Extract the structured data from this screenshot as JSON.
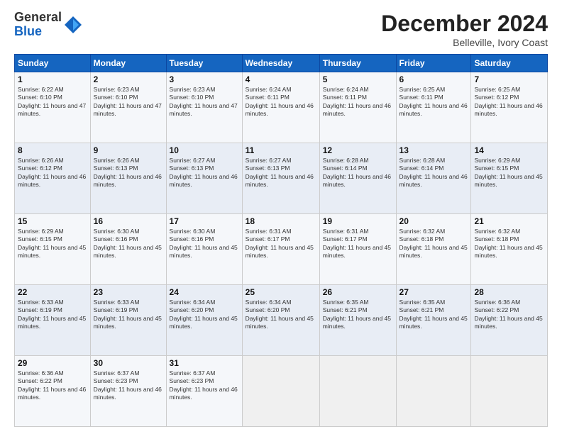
{
  "logo": {
    "general": "General",
    "blue": "Blue"
  },
  "title": "December 2024",
  "location": "Belleville, Ivory Coast",
  "days_header": [
    "Sunday",
    "Monday",
    "Tuesday",
    "Wednesday",
    "Thursday",
    "Friday",
    "Saturday"
  ],
  "weeks": [
    [
      {
        "day": "1",
        "sunrise": "6:22 AM",
        "sunset": "6:10 PM",
        "daylight": "11 hours and 47 minutes."
      },
      {
        "day": "2",
        "sunrise": "6:23 AM",
        "sunset": "6:10 PM",
        "daylight": "11 hours and 47 minutes."
      },
      {
        "day": "3",
        "sunrise": "6:23 AM",
        "sunset": "6:10 PM",
        "daylight": "11 hours and 47 minutes."
      },
      {
        "day": "4",
        "sunrise": "6:24 AM",
        "sunset": "6:11 PM",
        "daylight": "11 hours and 46 minutes."
      },
      {
        "day": "5",
        "sunrise": "6:24 AM",
        "sunset": "6:11 PM",
        "daylight": "11 hours and 46 minutes."
      },
      {
        "day": "6",
        "sunrise": "6:25 AM",
        "sunset": "6:11 PM",
        "daylight": "11 hours and 46 minutes."
      },
      {
        "day": "7",
        "sunrise": "6:25 AM",
        "sunset": "6:12 PM",
        "daylight": "11 hours and 46 minutes."
      }
    ],
    [
      {
        "day": "8",
        "sunrise": "6:26 AM",
        "sunset": "6:12 PM",
        "daylight": "11 hours and 46 minutes."
      },
      {
        "day": "9",
        "sunrise": "6:26 AM",
        "sunset": "6:13 PM",
        "daylight": "11 hours and 46 minutes."
      },
      {
        "day": "10",
        "sunrise": "6:27 AM",
        "sunset": "6:13 PM",
        "daylight": "11 hours and 46 minutes."
      },
      {
        "day": "11",
        "sunrise": "6:27 AM",
        "sunset": "6:13 PM",
        "daylight": "11 hours and 46 minutes."
      },
      {
        "day": "12",
        "sunrise": "6:28 AM",
        "sunset": "6:14 PM",
        "daylight": "11 hours and 46 minutes."
      },
      {
        "day": "13",
        "sunrise": "6:28 AM",
        "sunset": "6:14 PM",
        "daylight": "11 hours and 46 minutes."
      },
      {
        "day": "14",
        "sunrise": "6:29 AM",
        "sunset": "6:15 PM",
        "daylight": "11 hours and 45 minutes."
      }
    ],
    [
      {
        "day": "15",
        "sunrise": "6:29 AM",
        "sunset": "6:15 PM",
        "daylight": "11 hours and 45 minutes."
      },
      {
        "day": "16",
        "sunrise": "6:30 AM",
        "sunset": "6:16 PM",
        "daylight": "11 hours and 45 minutes."
      },
      {
        "day": "17",
        "sunrise": "6:30 AM",
        "sunset": "6:16 PM",
        "daylight": "11 hours and 45 minutes."
      },
      {
        "day": "18",
        "sunrise": "6:31 AM",
        "sunset": "6:17 PM",
        "daylight": "11 hours and 45 minutes."
      },
      {
        "day": "19",
        "sunrise": "6:31 AM",
        "sunset": "6:17 PM",
        "daylight": "11 hours and 45 minutes."
      },
      {
        "day": "20",
        "sunrise": "6:32 AM",
        "sunset": "6:18 PM",
        "daylight": "11 hours and 45 minutes."
      },
      {
        "day": "21",
        "sunrise": "6:32 AM",
        "sunset": "6:18 PM",
        "daylight": "11 hours and 45 minutes."
      }
    ],
    [
      {
        "day": "22",
        "sunrise": "6:33 AM",
        "sunset": "6:19 PM",
        "daylight": "11 hours and 45 minutes."
      },
      {
        "day": "23",
        "sunrise": "6:33 AM",
        "sunset": "6:19 PM",
        "daylight": "11 hours and 45 minutes."
      },
      {
        "day": "24",
        "sunrise": "6:34 AM",
        "sunset": "6:20 PM",
        "daylight": "11 hours and 45 minutes."
      },
      {
        "day": "25",
        "sunrise": "6:34 AM",
        "sunset": "6:20 PM",
        "daylight": "11 hours and 45 minutes."
      },
      {
        "day": "26",
        "sunrise": "6:35 AM",
        "sunset": "6:21 PM",
        "daylight": "11 hours and 45 minutes."
      },
      {
        "day": "27",
        "sunrise": "6:35 AM",
        "sunset": "6:21 PM",
        "daylight": "11 hours and 45 minutes."
      },
      {
        "day": "28",
        "sunrise": "6:36 AM",
        "sunset": "6:22 PM",
        "daylight": "11 hours and 45 minutes."
      }
    ],
    [
      {
        "day": "29",
        "sunrise": "6:36 AM",
        "sunset": "6:22 PM",
        "daylight": "11 hours and 46 minutes."
      },
      {
        "day": "30",
        "sunrise": "6:37 AM",
        "sunset": "6:23 PM",
        "daylight": "11 hours and 46 minutes."
      },
      {
        "day": "31",
        "sunrise": "6:37 AM",
        "sunset": "6:23 PM",
        "daylight": "11 hours and 46 minutes."
      },
      null,
      null,
      null,
      null
    ]
  ],
  "labels": {
    "sunrise": "Sunrise:",
    "sunset": "Sunset:",
    "daylight": "Daylight:"
  }
}
